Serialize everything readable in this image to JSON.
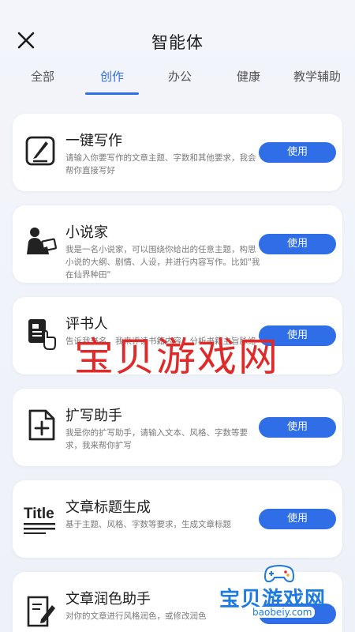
{
  "header": {
    "title": "智能体"
  },
  "tabs": [
    {
      "label": "全部",
      "active": false
    },
    {
      "label": "创作",
      "active": true
    },
    {
      "label": "办公",
      "active": false
    },
    {
      "label": "健康",
      "active": false
    },
    {
      "label": "教学辅助",
      "active": false
    }
  ],
  "cards": [
    {
      "title": "一键写作",
      "desc": "请输入你要写作的文章主题、字数和其他要求，我会帮你直接写好",
      "icon": "edit-icon",
      "button": "使用"
    },
    {
      "title": "小说家",
      "desc": "我是一名小说家，可以围绕你给出的任意主题，构思小说的大纲、剧情、人设，并进行内容写作。比如\"我在仙界种田\"",
      "icon": "writer-icon",
      "button": "使用"
    },
    {
      "title": "评书人",
      "desc": "告诉我书名，我来评读书籍内容，分析书籍主旨脉络",
      "icon": "book-reader-icon",
      "button": "使用"
    },
    {
      "title": "扩写助手",
      "desc": "我是你的扩写助手，请输入文本、风格、字数等要求，我来帮你扩写",
      "icon": "document-add-icon",
      "button": "使用"
    },
    {
      "title": "文章标题生成",
      "desc": "基于主题、风格、字数等要求，生成文章标题",
      "icon": "title-icon",
      "button": "使用"
    },
    {
      "title": "文章润色助手",
      "desc": "对你的文章进行风格润色，或修改润色",
      "icon": "polish-icon",
      "button": "使用"
    }
  ],
  "watermark": {
    "text": "宝贝游戏网",
    "logo_text": "宝贝游戏网",
    "logo_url": "baobeiy.com",
    "color": "#e02a2a",
    "logo_color": "#1e7be0"
  },
  "colors": {
    "accent": "#2f6ee6",
    "background": "#f3f5fb"
  }
}
